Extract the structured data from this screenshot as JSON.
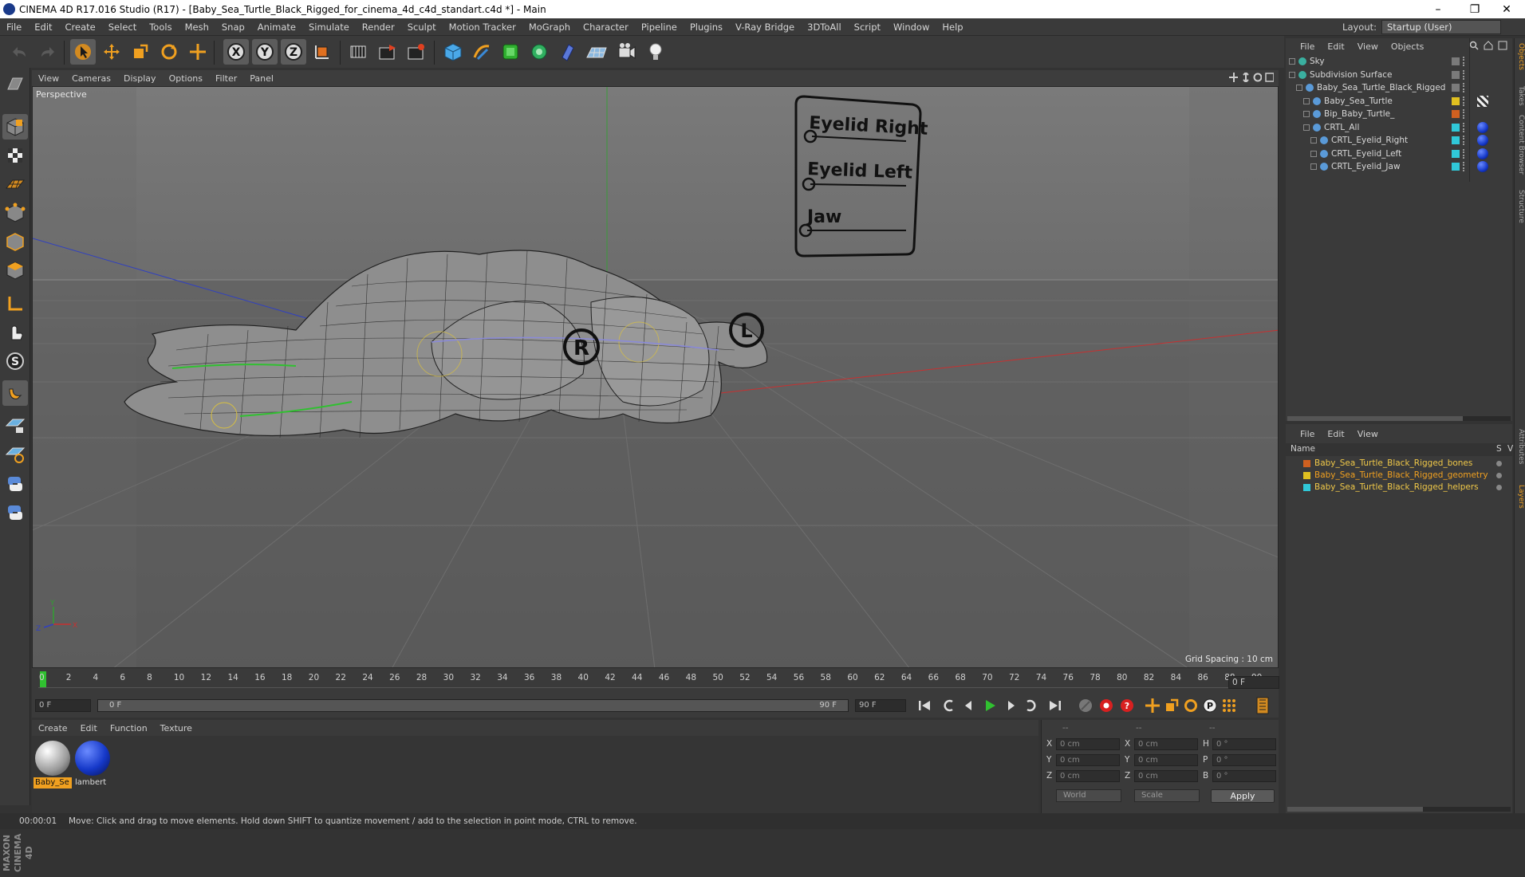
{
  "window": {
    "title": "CINEMA 4D R17.016 Studio (R17) - [Baby_Sea_Turtle_Black_Rigged_for_cinema_4d_c4d_standart.c4d *] - Main",
    "minimize": "–",
    "restore": "❐",
    "close": "✕"
  },
  "menubar": {
    "items": [
      "File",
      "Edit",
      "Create",
      "Select",
      "Tools",
      "Mesh",
      "Snap",
      "Animate",
      "Simulate",
      "Render",
      "Sculpt",
      "Motion Tracker",
      "MoGraph",
      "Character",
      "Pipeline",
      "Plugins",
      "V-Ray Bridge",
      "3DToAll",
      "Script",
      "Window",
      "Help"
    ],
    "layout_label": "Layout:",
    "layout_value": "Startup (User)"
  },
  "viewport": {
    "menu": [
      "View",
      "Cameras",
      "Display",
      "Options",
      "Filter",
      "Panel"
    ],
    "label": "Perspective",
    "grid_spacing": "Grid Spacing : 10 cm",
    "control_board": {
      "labels": [
        "Eyelid Right",
        "Eyelid Left",
        "Jaw"
      ]
    },
    "handle_r": "R",
    "handle_l": "L",
    "axis_y": "Y",
    "axis_x": "X",
    "axis_z": "Z"
  },
  "timeline": {
    "ticks": [
      "0",
      "2",
      "4",
      "6",
      "8",
      "10",
      "12",
      "14",
      "16",
      "18",
      "20",
      "22",
      "24",
      "26",
      "28",
      "30",
      "32",
      "34",
      "36",
      "38",
      "40",
      "42",
      "44",
      "46",
      "48",
      "50",
      "52",
      "54",
      "56",
      "58",
      "60",
      "62",
      "64",
      "66",
      "68",
      "70",
      "72",
      "74",
      "76",
      "78",
      "80",
      "82",
      "84",
      "86",
      "88",
      "90"
    ],
    "current_frame": "0 F",
    "start_field": "0 F",
    "range_start": "0 F",
    "range_end": "90 F",
    "end_field": "90 F"
  },
  "materials": {
    "menu": [
      "Create",
      "Edit",
      "Function",
      "Texture"
    ],
    "items": [
      {
        "name": "Baby_Se",
        "color": "#d8d8d8"
      },
      {
        "name": "lambert",
        "color": "#1538c8"
      }
    ]
  },
  "coordinates": {
    "header": [
      "--",
      "--",
      "--"
    ],
    "rows": [
      {
        "a": "X",
        "av": "0 cm",
        "b": "X",
        "bv": "0 cm",
        "c": "H",
        "cv": "0 °"
      },
      {
        "a": "Y",
        "av": "0 cm",
        "b": "Y",
        "bv": "0 cm",
        "c": "P",
        "cv": "0 °"
      },
      {
        "a": "Z",
        "av": "0 cm",
        "b": "Z",
        "bv": "0 cm",
        "c": "B",
        "cv": "0 °"
      }
    ],
    "world": "World",
    "scale": "Scale",
    "apply": "Apply"
  },
  "status": {
    "time": "00:00:01",
    "message": "Move: Click and drag to move elements. Hold down SHIFT to quantize movement / add to the selection in point mode, CTRL to remove."
  },
  "objects_panel": {
    "menu": [
      "File",
      "Edit",
      "View",
      "Objects"
    ],
    "rows": [
      {
        "name": "Sky",
        "indent": 0,
        "tag": "#7a7a7a"
      },
      {
        "name": "Subdivision Surface",
        "indent": 0,
        "tag": "#7a7a7a"
      },
      {
        "name": "Baby_Sea_Turtle_Black_Rigged",
        "indent": 1,
        "tag": "#7a7a7a"
      },
      {
        "name": "Baby_Sea_Turtle",
        "indent": 2,
        "tag": "#e0c020"
      },
      {
        "name": "Bip_Baby_Turtle_",
        "indent": 2,
        "tag": "#d06020"
      },
      {
        "name": "CRTL_All",
        "indent": 2,
        "tag": "#30c8d8"
      },
      {
        "name": "CRTL_Eyelid_Right",
        "indent": 3,
        "tag": "#30c8d8"
      },
      {
        "name": "CRTL_Eyelid_Left",
        "indent": 3,
        "tag": "#30c8d8"
      },
      {
        "name": "CRTL_Eyelid_Jaw",
        "indent": 3,
        "tag": "#30c8d8"
      }
    ]
  },
  "layers_panel": {
    "menu": [
      "File",
      "Edit",
      "View"
    ],
    "header_name": "Name",
    "header_s": "S",
    "header_v": "V",
    "rows": [
      {
        "name": "Baby_Sea_Turtle_Black_Rigged_bones",
        "color": "#d06020",
        "highlight": false
      },
      {
        "name": "Baby_Sea_Turtle_Black_Rigged_geometry",
        "color": "#e0c020",
        "highlight": true
      },
      {
        "name": "Baby_Sea_Turtle_Black_Rigged_helpers",
        "color": "#30c8d8",
        "highlight": false
      }
    ]
  },
  "right_tabs": [
    "Objects",
    "Takes",
    "Content Browser",
    "Structure",
    "Attributes",
    "Layers"
  ],
  "brand": "MAXON CINEMA 4D",
  "colors": {
    "accent_orange": "#f0a020",
    "axis_x": "#c83030",
    "axis_y": "#30a030",
    "axis_z": "#3040c0"
  }
}
